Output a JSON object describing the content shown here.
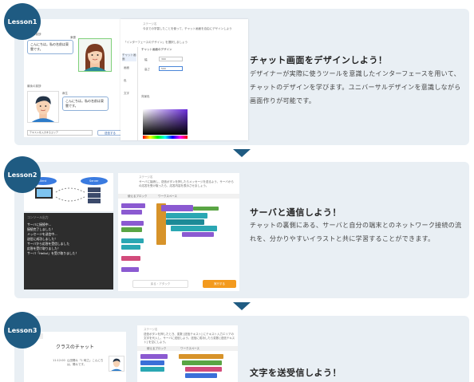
{
  "lessons": [
    {
      "badge": "Lesson1",
      "title": "チャット画面をデザインしよう！",
      "description": "デザイナーが実際に使うツールを意識したインターフェースを用いて、チャットのデザインを学びます。ユニバーサルデザインを意識しながら画面作りが可能です。",
      "screenshot": {
        "bubble_1": "こんにちは。私の名前は東雲です。",
        "bubble_2": "こんにちは。私の名前は東雲です。",
        "name_1": "東雲",
        "name_2": "麻生",
        "label_top": "最初の挨拶",
        "label_mid": "最後の挨拶",
        "input_placeholder": "テキストを入力するエリア",
        "send_button": "送信する",
        "tip": "ステージ名",
        "tip_text": "今までの学習したことを使って、チャット画面を自由にデザインしよう",
        "section_label": "「インターフェースのデザイン」を選択しましょう",
        "tab_labels": [
          "チャット画面",
          "画面",
          "色",
          "文字",
          "その他"
        ],
        "prop_title": "チャット画面のデザイン",
        "field_1_label": "幅",
        "field_1_value": "300",
        "field_2_label": "高さ",
        "field_2_value": "500",
        "color_label": "背景色"
      }
    },
    {
      "badge": "Lesson2",
      "title": "サーバと通信しよう！",
      "description": "チャットの裏側にある、サーバと自分の端末とのネットワーク接続の流れを、分かりやすいイラストと共に学習することができます。",
      "screenshot": {
        "client": "Client",
        "server": "Server",
        "request": "Request",
        "response": "Response",
        "console_title": "コンソール出力",
        "console_lines": [
          "サーバに接続中...",
          "接続完了しました！",
          "メッセージを送信中...",
          "送信に成功しました！",
          "サーバから応答を受信しました",
          "応答を受け取りました！",
          "サーバ「Hello!」を受け取りました！"
        ],
        "stage_label": "ステージ名",
        "stage_text": "サーバに接続し、送信ボタンを押したらメッセージを送るよう、サーバからの応答を受け取ったら、応答内容を表示させましょう。",
        "block_header": "使えるブロック",
        "work_header": "ワークスペース",
        "back_button": "戻る・アタック",
        "run_button": "実行する"
      }
    },
    {
      "badge": "Lesson3",
      "title": "文字を送受信しよう！",
      "screenshot": {
        "tab": "テキスト",
        "chat_title": "クラスのチャット",
        "msg_time": "11:12:00",
        "msg_text": "山田陽斗「1 時之」こんにちは。陽斗です。",
        "stage_label": "ステージ名",
        "stage_text": "送信ボタンを押したとき、変数 [送信テキスト] にテキスト入力エリアの文字を代入し、サーバに送信しよう。送信に成功したら変数 [送信テキスト] を空にしよう。",
        "block_header": "使えるブロック",
        "work_header": "ワークスペース"
      }
    }
  ],
  "colors": {
    "badge": "#1f5b82",
    "panel": "#e9eff4",
    "accent_orange": "#f39a1e"
  }
}
